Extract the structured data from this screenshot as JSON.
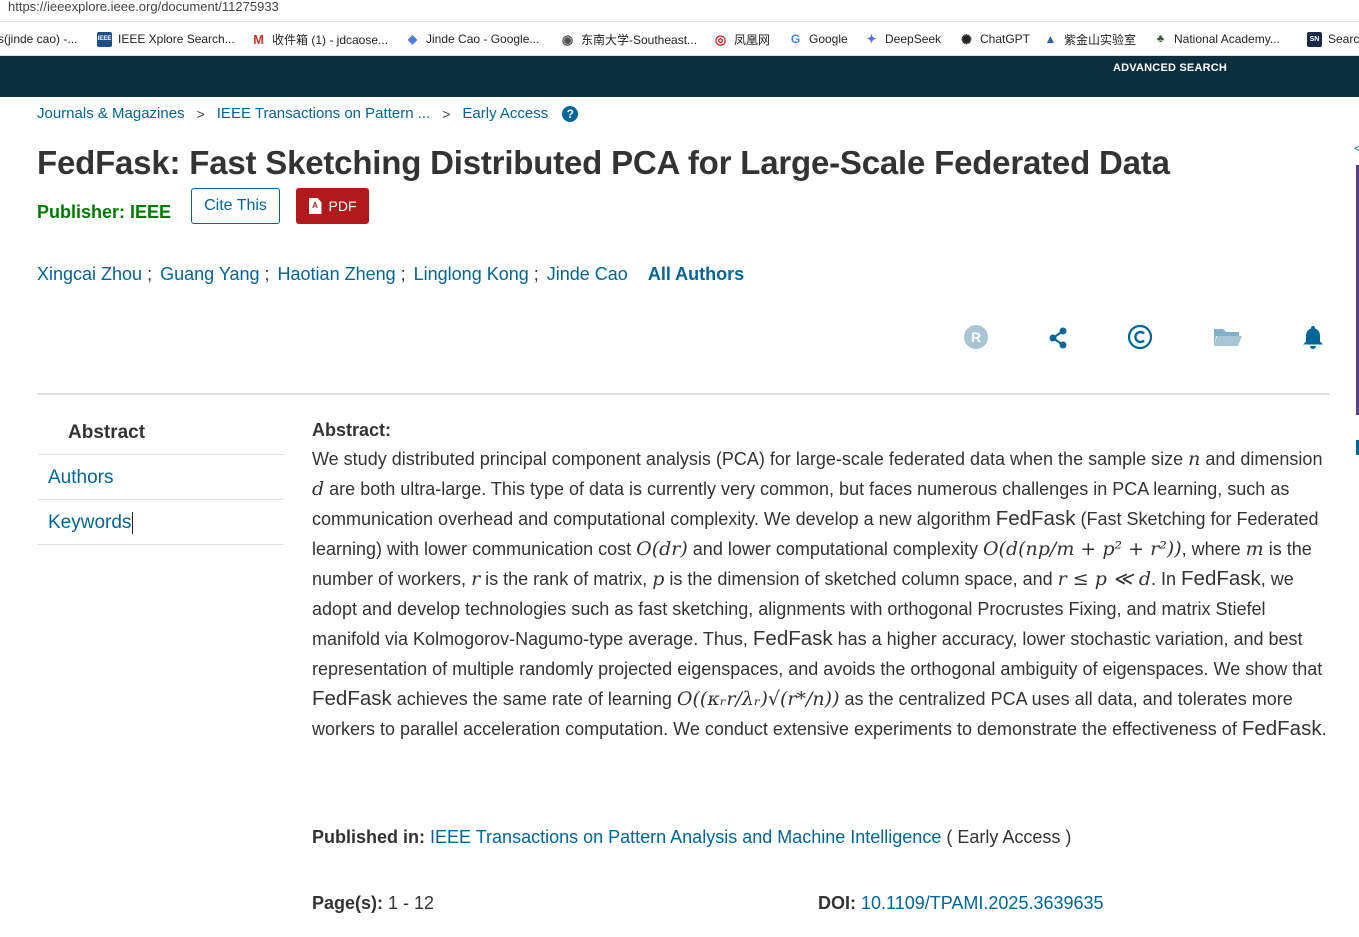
{
  "browser": {
    "url": "https://ieeexplore.ieee.org/document/11275933",
    "bookmarks": [
      {
        "label": "s(jinde cao) -...",
        "icon": "none",
        "fav": ""
      },
      {
        "label": "IEEE Xplore Search...",
        "icon": "ieee-icon",
        "fav": "IEEE"
      },
      {
        "label": "收件箱 (1) - jdcaose...",
        "icon": "gmail-icon",
        "fav": "M"
      },
      {
        "label": "Jinde Cao - Google...",
        "icon": "scholar-icon",
        "fav": "◆"
      },
      {
        "label": "东南大学-Southeast...",
        "icon": "seu-icon",
        "fav": "◉"
      },
      {
        "label": "凤凰网",
        "icon": "ifeng-icon",
        "fav": "◎"
      },
      {
        "label": "Google",
        "icon": "google-icon",
        "fav": "G"
      },
      {
        "label": "DeepSeek",
        "icon": "deepseek-icon",
        "fav": "✦"
      },
      {
        "label": "ChatGPT",
        "icon": "chatgpt-icon",
        "fav": "✺"
      },
      {
        "label": "紫金山实验室",
        "icon": "pml-icon",
        "fav": "▲"
      },
      {
        "label": "National Academy...",
        "icon": "nas-icon",
        "fav": "♣"
      },
      {
        "label": "Searc",
        "icon": "sn-icon",
        "fav": "SN"
      }
    ]
  },
  "header": {
    "advanced_search": "ADVANCED SEARCH"
  },
  "breadcrumb": {
    "items": [
      "Journals & Magazines",
      "IEEE Transactions on Pattern ...",
      "Early Access"
    ],
    "separator": ">",
    "help": "?"
  },
  "article": {
    "title": "FedFask: Fast Sketching Distributed PCA for Large-Scale Federated Data",
    "publisher_label": "Publisher:",
    "publisher": "IEEE",
    "cite_label": "Cite This",
    "pdf_label": "PDF",
    "pdf_icon_text": "A",
    "authors": [
      "Xingcai Zhou",
      "Guang Yang",
      "Haotian Zheng",
      "Linglong Kong",
      "Jinde Cao"
    ],
    "author_separator": ";",
    "all_authors_label": "All Authors"
  },
  "tools": [
    {
      "name": "rights-icon",
      "glyph": "R"
    },
    {
      "name": "share-icon",
      "glyph": ""
    },
    {
      "name": "copyright-icon",
      "glyph": "©"
    },
    {
      "name": "folder-icon",
      "glyph": ""
    },
    {
      "name": "alert-bell-icon",
      "glyph": ""
    }
  ],
  "sidenav": {
    "abstract": "Abstract",
    "authors": "Authors",
    "keywords": "Keywords"
  },
  "abstract": {
    "heading": "Abstract:",
    "t1": "We study distributed principal component analysis (PCA) for large-scale federated data when the sample size ",
    "m1": "n",
    "t2": " and dimension ",
    "m2": "d",
    "t3": " are both ultra-large. This type of data is currently very common, but faces numerous challenges in PCA learning, such as communication overhead and computational complexity. We develop a new algorithm ",
    "brand": "FedFask",
    "t4": " (Fast Sketching for Federated learning) with lower communication cost ",
    "m3": "O(dr)",
    "t5": " and lower computational complexity ",
    "m4": "O(d(np/m + p² + r²))",
    "t6": ", where ",
    "m5": "m",
    "t7": " is the number of workers, ",
    "m6": "r",
    "t8": " is the rank of matrix, ",
    "m7": "p",
    "t9": " is the dimension of sketched column space, and ",
    "m8": "r ≤ p ≪ d",
    "t10": ". In ",
    "t11": ", we adopt and develop technologies such as fast sketching, alignments with orthogonal Procrustes Fixing, and matrix Stiefel manifold via Kolmogorov-Nagumo-type average. Thus, ",
    "t12": " has a higher accuracy, lower stochastic variation, and best representation of multiple randomly projected eigenspaces, and avoids the orthogonal ambiguity of eigenspaces. We show that ",
    "t13": " achieves the same rate of learning ",
    "m9": "O((κᵣr/λᵣ)√(r*/n))",
    "t14": " as the centralized PCA uses all data, and tolerates more workers to parallel acceleration computation. We conduct extensive experiments to demonstrate the effectiveness of ",
    "t15": "."
  },
  "published_in": {
    "label": "Published in:",
    "journal": "IEEE Transactions on Pattern Analysis and Machine Intelligence",
    "status": "( Early Access )"
  },
  "meta": {
    "pages_label": "Page(s):",
    "pages": "1 - 12",
    "doi_label": "DOI:",
    "doi": "10.1109/TPAMI.2025.3639635"
  },
  "right_edge": {
    "chevron": "<"
  },
  "colors": {
    "link": "#006699",
    "publisher": "#007a00",
    "pdf": "#b3191c",
    "header_bar": "#0b2f3d"
  }
}
